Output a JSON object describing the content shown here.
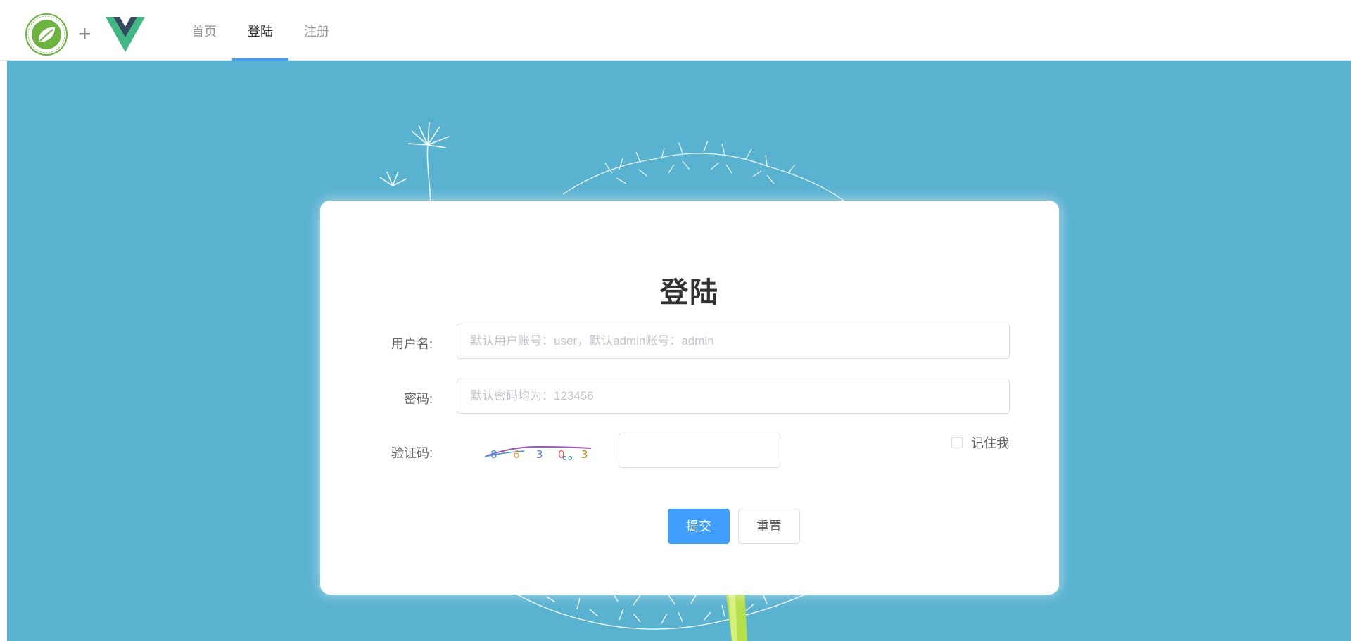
{
  "header": {
    "logos": {
      "spring": "spring-leaf-logo",
      "plus": "+",
      "vue": "vue-logo"
    },
    "nav": [
      {
        "label": "首页",
        "active": false
      },
      {
        "label": "登陆",
        "active": true
      },
      {
        "label": "注册",
        "active": false
      }
    ],
    "active_color": "#409eff"
  },
  "background": {
    "color": "#5ab2d1",
    "image": "dandelion"
  },
  "login": {
    "title": "登陆",
    "username_label": "用户名:",
    "username_placeholder": "默认用户账号：user，默认admin账号：admin",
    "username_value": "",
    "password_label": "密码:",
    "password_placeholder": "默认密码均为：123456",
    "password_value": "",
    "captcha_label": "验证码:",
    "captcha_text": [
      "8",
      "6",
      "3",
      "0",
      "o",
      "o",
      "3"
    ],
    "captcha_value": "",
    "remember_label": "记住我",
    "remember_checked": false,
    "submit_label": "提交",
    "reset_label": "重置"
  }
}
